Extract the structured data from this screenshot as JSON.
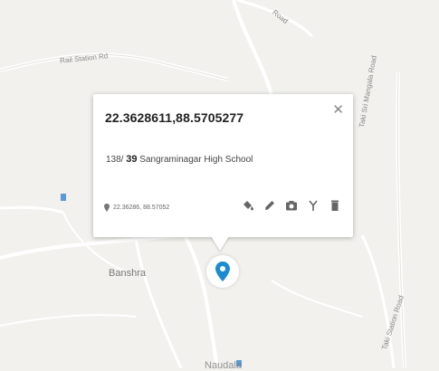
{
  "popup": {
    "title": "22.3628611,88.5705277",
    "address_prefix": "138/",
    "address_number": "39",
    "address_place": "Sangraminagar High School",
    "coords_short": "22.36286, 88.57052"
  },
  "map": {
    "road_labels": {
      "rail_station": "Rail Station Rd",
      "top_road": "Road",
      "right_road": "Taki Sri Mangala Road",
      "bottom_right_road": "Taki Station Road"
    },
    "places": {
      "banshra": "Banshra",
      "bottom_place": "Naudala"
    }
  },
  "colors": {
    "accent": "#1b8ccf",
    "popup_bg": "#ffffff",
    "map_bg": "#f2f1ee",
    "road": "#ffffff"
  },
  "icons": [
    "close-icon",
    "location-pin-icon",
    "paint-bucket-icon",
    "pencil-icon",
    "camera-icon",
    "fork-icon",
    "trash-icon",
    "map-marker-icon"
  ]
}
